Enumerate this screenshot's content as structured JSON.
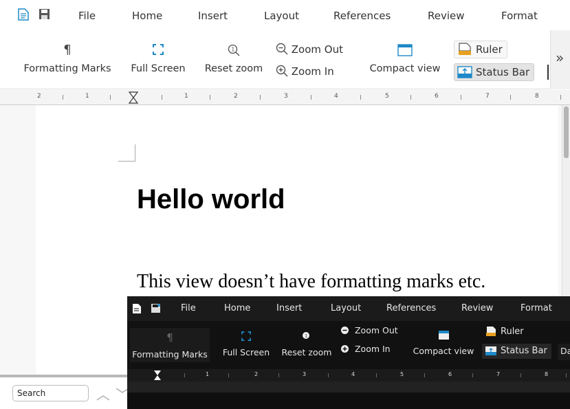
{
  "light": {
    "menu": [
      "File",
      "Home",
      "Insert",
      "Layout",
      "References",
      "Review",
      "Format"
    ],
    "ribbon": {
      "formatting_marks": "Formatting Marks",
      "full_screen": "Full Screen",
      "reset_zoom": "Reset zoom",
      "zoom_out": "Zoom Out",
      "zoom_in": "Zoom In",
      "compact_view": "Compact view",
      "ruler": "Ruler",
      "status_bar": "Status Bar",
      "more": "»"
    },
    "ruler_labels": [
      "2",
      "1",
      "1",
      "2",
      "3",
      "4",
      "5",
      "6",
      "7",
      "8"
    ],
    "document": {
      "heading": "Hello world",
      "paragraph": "This view doesn’t have formatting marks etc."
    },
    "search": {
      "value": "Search"
    }
  },
  "dark": {
    "menu": [
      "File",
      "Home",
      "Insert",
      "Layout",
      "References",
      "Review",
      "Format"
    ],
    "ribbon": {
      "formatting_marks": "Formatting Marks",
      "full_screen": "Full Screen",
      "reset_zoom": "Reset zoom",
      "zoom_out": "Zoom Out",
      "zoom_in": "Zoom In",
      "compact_view": "Compact view",
      "ruler": "Ruler",
      "status_bar": "Status Bar",
      "overflow": "Da"
    },
    "ruler_labels": [
      "1",
      "2",
      "3",
      "4",
      "5",
      "6",
      "7",
      "8"
    ]
  },
  "colors": {
    "accent": "#1e88c8",
    "ruler_icon": "#e8a020",
    "dark_bg": "#0f0f0f"
  }
}
